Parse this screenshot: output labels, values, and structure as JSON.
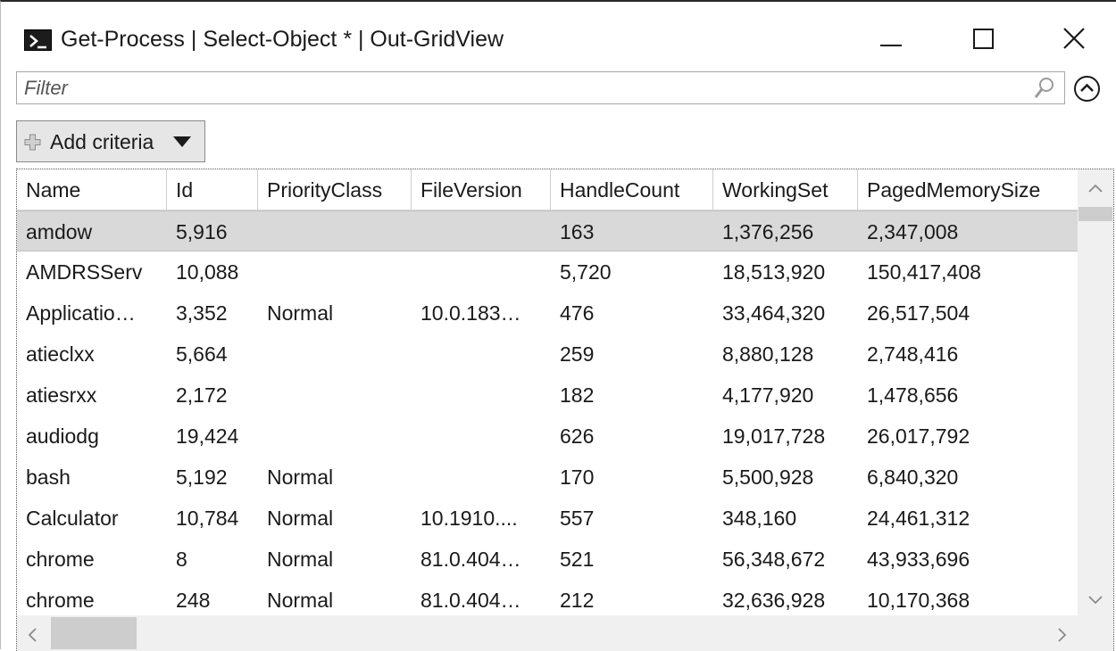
{
  "window": {
    "title": "Get-Process | Select-Object * | Out-GridView",
    "app_icon": "powershell-icon",
    "controls": [
      "minimize-icon",
      "maximize-icon",
      "close-icon"
    ]
  },
  "filter": {
    "placeholder": "Filter",
    "value": "",
    "icon": "search-icon",
    "collapse_icon": "chevron-up-circle-icon"
  },
  "criteria": {
    "label": "Add criteria",
    "icon": "plus-icon",
    "caret": "caret-down-icon"
  },
  "grid": {
    "columns": [
      "Name",
      "Id",
      "PriorityClass",
      "FileVersion",
      "HandleCount",
      "WorkingSet",
      "PagedMemorySize"
    ],
    "selected_row_index": 0,
    "rows": [
      [
        "amdow",
        "5,916",
        "",
        "",
        "163",
        "1,376,256",
        "2,347,008"
      ],
      [
        "AMDRSServ",
        "10,088",
        "",
        "",
        "5,720",
        "18,513,920",
        "150,417,408"
      ],
      [
        "Applicatio…",
        "3,352",
        "Normal",
        "10.0.183…",
        "476",
        "33,464,320",
        "26,517,504"
      ],
      [
        "atieclxx",
        "5,664",
        "",
        "",
        "259",
        "8,880,128",
        "2,748,416"
      ],
      [
        "atiesrxx",
        "2,172",
        "",
        "",
        "182",
        "4,177,920",
        "1,478,656"
      ],
      [
        "audiodg",
        "19,424",
        "",
        "",
        "626",
        "19,017,728",
        "26,017,792"
      ],
      [
        "bash",
        "5,192",
        "Normal",
        "",
        "170",
        "5,500,928",
        "6,840,320"
      ],
      [
        "Calculator",
        "10,784",
        "Normal",
        "10.1910....",
        "557",
        "348,160",
        "24,461,312"
      ],
      [
        "chrome",
        "8",
        "Normal",
        "81.0.404…",
        "521",
        "56,348,672",
        "43,933,696"
      ],
      [
        "chrome",
        "248",
        "Normal",
        "81.0.404…",
        "212",
        "32,636,928",
        "10,170,368"
      ]
    ]
  },
  "scrollbars": {
    "vertical": {
      "up_icon": "scroll-up-icon",
      "down_icon": "scroll-down-icon"
    },
    "horizontal": {
      "left_icon": "scroll-left-icon",
      "right_icon": "scroll-right-icon"
    }
  }
}
